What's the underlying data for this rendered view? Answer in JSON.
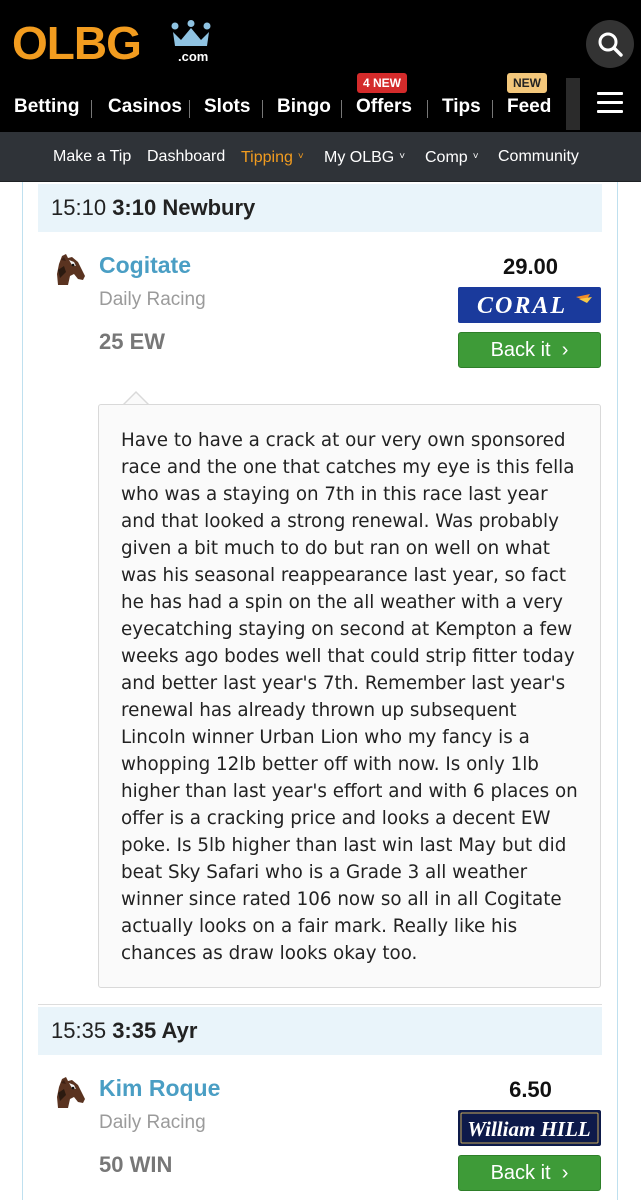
{
  "header": {
    "logo_text": "OLBG",
    "logo_suffix": ".com",
    "nav": [
      {
        "label": "Betting"
      },
      {
        "label": "Casinos"
      },
      {
        "label": "Slots"
      },
      {
        "label": "Bingo"
      },
      {
        "label": "Offers",
        "badge": "4 NEW"
      },
      {
        "label": "Tips"
      },
      {
        "label": "Feed",
        "badge": "NEW"
      }
    ],
    "icons": {
      "search": "search-icon",
      "menu": "hamburger-menu-icon"
    },
    "colors": {
      "brand": "#f29c1f",
      "background": "#000000",
      "offers_badge": "#d42b2b",
      "new_badge": "#f3c77b"
    }
  },
  "subnav": {
    "items": [
      {
        "label": "Make a Tip"
      },
      {
        "label": "Dashboard"
      },
      {
        "label": "Tipping",
        "active": true
      },
      {
        "label": "My OLBG"
      },
      {
        "label": "Comp"
      },
      {
        "label": "Community"
      }
    ],
    "dropdown_caret": "˅"
  },
  "races": [
    {
      "time_24": "15:10",
      "race_name": "3:10 Newbury",
      "tip": {
        "horse": "Cogitate",
        "category": "Daily Racing",
        "stake": "25 EW",
        "odds": "29.00",
        "bookmaker": "CORAL",
        "button_label": "Back it",
        "comment": "Have to have a crack at our very own sponsored race and the one that catches my eye is this fella who was a staying on 7th in this race last year and that looked a strong renewal. Was probably given a bit much to do but ran on well on what was his seasonal reappearance last year, so fact he has had a spin on the all weather with a very eyecatching staying on second at Kempton a few weeks ago bodes well that could strip fitter today and better last year's 7th. Remember last year's renewal has already thrown up subsequent Lincoln winner Urban Lion who my fancy is a whopping 12lb better off with now. Is only 1lb higher than last year's effort and with 6 places on offer is a cracking price and looks a decent EW poke. Is 5lb higher than last win last May but did beat Sky Safari who is a Grade 3 all weather winner since rated 106 now so all in all Cogitate actually looks on a fair mark. Really like his chances as draw looks okay too."
      }
    },
    {
      "time_24": "15:35",
      "race_name": "3:35 Ayr",
      "tip": {
        "horse": "Kim Roque",
        "category": "Daily Racing",
        "stake": "50 WIN",
        "odds": "6.50",
        "bookmaker": "William HILL",
        "button_label": "Back it"
      }
    }
  ],
  "colors": {
    "horse_link": "#4a9ec4",
    "back_button": "#3e9b38",
    "race_header_bg": "#e9f4fa",
    "coral_blue": "#1a3a9c",
    "william_hill_navy": "#0d1a4a"
  }
}
